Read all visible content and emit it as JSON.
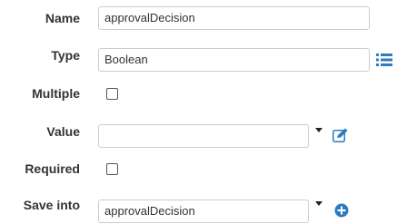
{
  "fields": {
    "name": {
      "label": "Name",
      "value": "approvalDecision"
    },
    "type": {
      "label": "Type",
      "value": "Boolean"
    },
    "multiple": {
      "label": "Multiple",
      "checked": false
    },
    "value": {
      "label": "Value",
      "value": ""
    },
    "required": {
      "label": "Required",
      "checked": false
    },
    "save_into": {
      "label": "Save into",
      "value": "approvalDecision"
    }
  },
  "icons": {
    "type_list": "list-icon",
    "value_edit": "edit-icon",
    "save_add": "plus-circle-icon"
  },
  "colors": {
    "accent": "#2e7bbf",
    "label": "#333333",
    "border": "#cccccc"
  }
}
